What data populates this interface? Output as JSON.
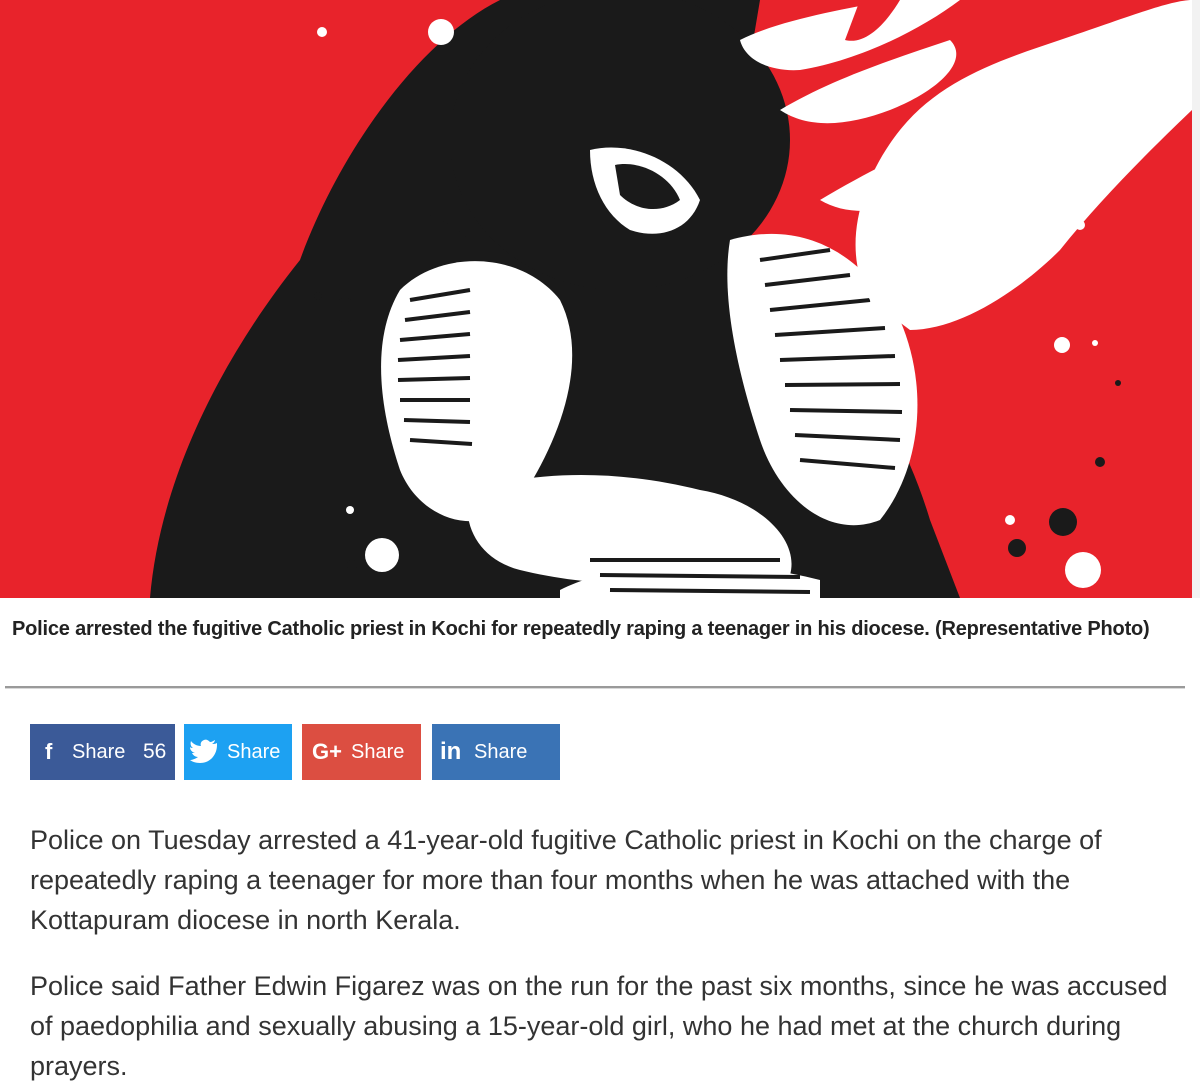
{
  "image": {
    "alt_icon": "representative-illustration",
    "colors": {
      "background": "#e8232b",
      "figure": "#1a1a1a",
      "highlight": "#ffffff"
    }
  },
  "caption": "Police arrested the fugitive Catholic priest in Kochi for repeatedly raping a teenager in his diocese. (Representative Photo)",
  "share": {
    "facebook": {
      "icon": "f",
      "label": "Share",
      "count": "56",
      "color": "#3b5a98"
    },
    "twitter": {
      "label": "Share",
      "color": "#1da1f2"
    },
    "googleplus": {
      "icon": "G+",
      "label": "Share",
      "color": "#dc4e41"
    },
    "linkedin": {
      "icon": "in",
      "label": "Share",
      "color": "#3a73b5"
    }
  },
  "article": {
    "paragraphs": [
      "Police on Tuesday arrested a 41-year-old fugitive Catholic priest in Kochi on the charge of repeatedly raping a teenager for more than four months when he was attached with the Kottapuram diocese in north Kerala.",
      "Police said Father Edwin Figarez was on the run for the past six months, since he was accused of paedophilia and sexually abusing a 15-year-old girl, who he had met at the church during prayers."
    ]
  }
}
